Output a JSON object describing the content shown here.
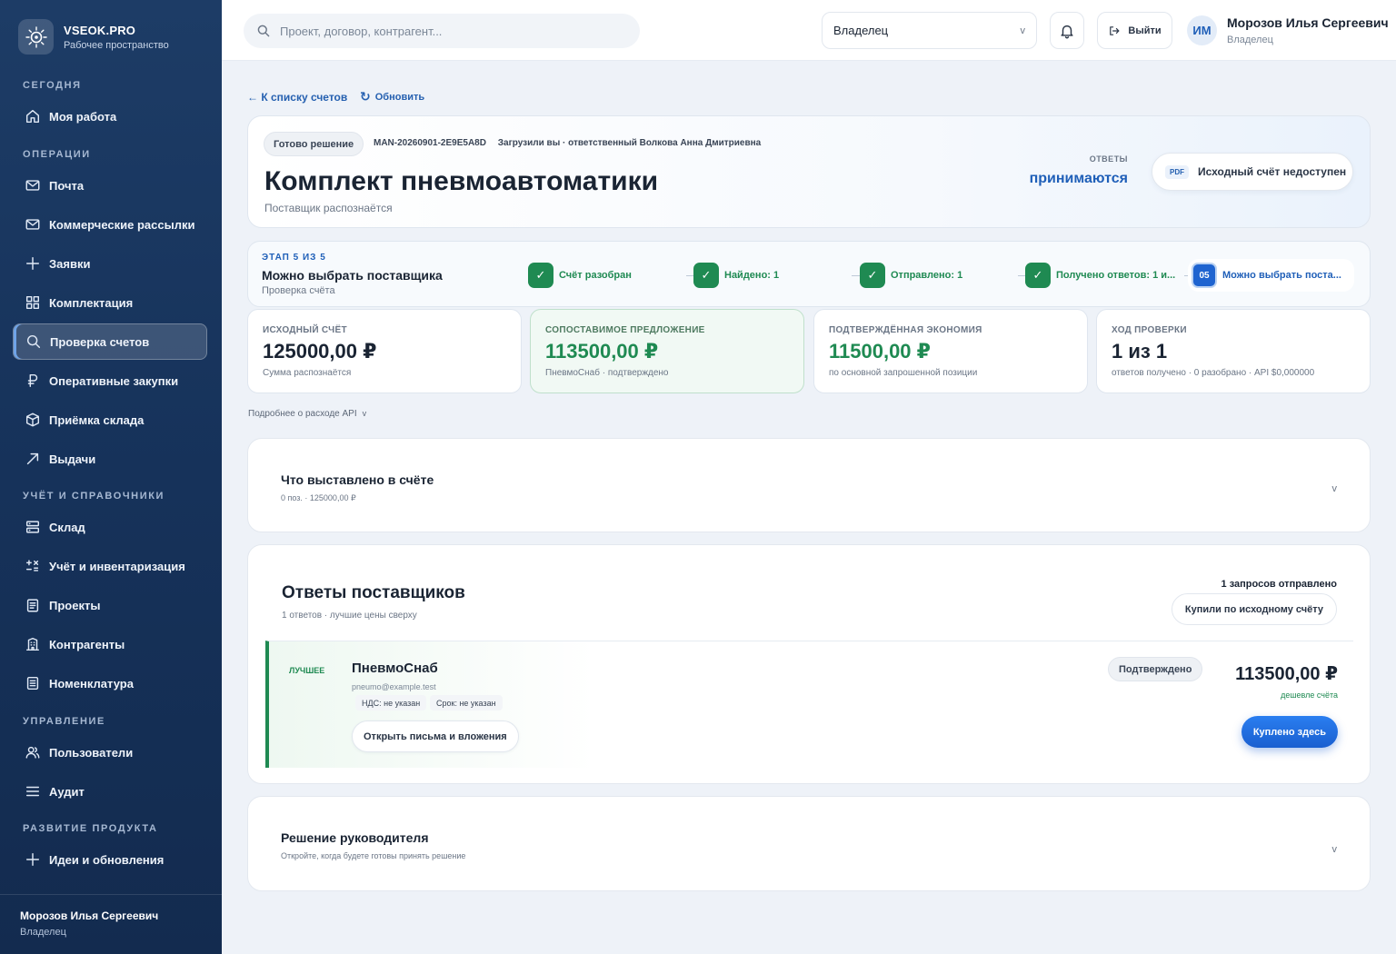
{
  "brand": {
    "name": "VSEOK.PRO",
    "subtitle": "Рабочее пространство"
  },
  "sidebar": {
    "sections": {
      "today": "СЕГОДНЯ",
      "operations": "ОПЕРАЦИИ",
      "accounting": "УЧЁТ И СПРАВОЧНИКИ",
      "management": "УПРАВЛЕНИЕ",
      "product": "РАЗВИТИЕ ПРОДУКТА"
    },
    "items": {
      "my_work": "Моя работа",
      "mail": "Почта",
      "newsletters": "Коммерческие рассылки",
      "requests": "Заявки",
      "kitting": "Комплектация",
      "invoice_check": "Проверка счетов",
      "quick_purchases": "Оперативные закупки",
      "warehouse_receipt": "Приёмка склада",
      "issues": "Выдачи",
      "warehouse": "Склад",
      "inventory": "Учёт и инвентаризация",
      "projects": "Проекты",
      "counterparties": "Контрагенты",
      "nomenclature": "Номенклатура",
      "users": "Пользователи",
      "audit": "Аудит",
      "ideas": "Идеи и обновления"
    },
    "footer": {
      "name": "Морозов Илья Сергеевич",
      "role": "Владелец"
    }
  },
  "topbar": {
    "search_placeholder": "Проект, договор, контрагент...",
    "role_value": "Владелец",
    "logout_label": "Выйти",
    "avatar_initials": "ИМ",
    "user_name": "Морозов Илья Сергеевич",
    "user_role": "Владелец"
  },
  "nav": {
    "back_label": "← К списку счетов",
    "refresh_label": "Обновить"
  },
  "header": {
    "status": "Готово решение",
    "code": "MAN-20260901-2E9E5A8D",
    "uploaded": "Загрузили вы · ответственный Волкова Анна Дмитриевна",
    "title": "Комплект пневмоавтоматики",
    "subtitle": "Поставщик распознаётся",
    "answers_label": "ОТВЕТЫ",
    "answers_value": "принимаются",
    "pdf_tag": "PDF",
    "pdf_label": "Исходный счёт недоступен"
  },
  "stage": {
    "label": "ЭТАП 5 ИЗ 5",
    "title": "Можно выбрать поставщика",
    "subtitle": "Проверка счёта",
    "steps": [
      {
        "mark": "✓",
        "label": "Счёт разобран"
      },
      {
        "mark": "✓",
        "label": "Найдено: 1"
      },
      {
        "mark": "✓",
        "label": "Отправлено: 1"
      },
      {
        "mark": "✓",
        "label": "Получено ответов: 1 и..."
      },
      {
        "mark": "05",
        "label": "Можно выбрать поста..."
      }
    ]
  },
  "metrics": [
    {
      "label": "ИСХОДНЫЙ СЧЁТ",
      "value": "125000,00 ₽",
      "note": "Сумма распознаётся"
    },
    {
      "label": "СОПОСТАВИМОЕ ПРЕДЛОЖЕНИЕ",
      "value": "113500,00 ₽",
      "note": "ПневмоСнаб · подтверждено"
    },
    {
      "label": "ПОДТВЕРЖДЁННАЯ ЭКОНОМИЯ",
      "value": "11500,00 ₽",
      "note": "по основной запрошенной позиции"
    },
    {
      "label": "ХОД ПРОВЕРКИ",
      "value": "1 из 1",
      "note": "ответов получено · 0 разобрано · API $0,000000"
    }
  ],
  "api_toggle": "Подробнее о расходе API",
  "invoice_panel": {
    "title": "Что выставлено в счёте",
    "subtitle": "0 поз. · 125000,00 ₽"
  },
  "responses": {
    "title": "Ответы поставщиков",
    "subtitle": "1 ответов · лучшие цены сверху",
    "requests_sent": "1 запросов отправлено",
    "bought_original": "Купили по исходному счёту",
    "supplier": {
      "tag": "ЛУЧШЕЕ",
      "name": "ПневмоСнаб",
      "email": "pneumo@example.test",
      "vat": "НДС: не указан",
      "term": "Срок: не указан",
      "open_mail": "Открыть письма и вложения",
      "status": "Подтверждено",
      "price": "113500,00 ₽",
      "cheaper": "дешевле счёта",
      "buy_here": "Куплено здесь"
    }
  },
  "decision_panel": {
    "title": "Решение руководителя",
    "subtitle": "Откройте, когда будете готовы принять решение"
  },
  "chevron": "v"
}
